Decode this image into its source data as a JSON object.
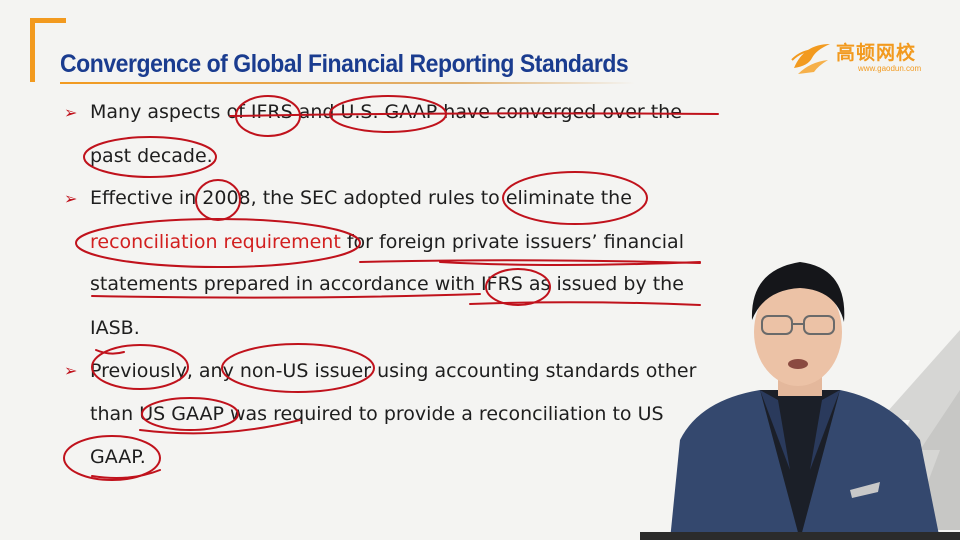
{
  "slide": {
    "title": "Convergence of Global Financial Reporting Standards",
    "logo": {
      "chinese": "高顿网校",
      "url": "www.gaodun.com"
    },
    "lines": {
      "l1": "Many aspects of IFRS and U.S. GAAP have converged over the",
      "l2": "past decade.",
      "l3": "Effective in 2008, the SEC adopted rules to eliminate the",
      "l4_red": "reconciliation requirement",
      "l4_rest": " for foreign private issuers’ financial",
      "l5": "statements prepared in accordance with IFRS as issued by the",
      "l6": "IASB.",
      "l7": "Previously, any non-US issuer using accounting standards other",
      "l8": "than US GAAP was required to provide a reconciliation to US",
      "l9": "GAAP."
    },
    "bullet_glyph": "➢"
  },
  "colors": {
    "title": "#1a3c8f",
    "accent": "#f29a1f",
    "ink_annotation": "#c0121c",
    "highlight_text": "#d21f1f"
  }
}
